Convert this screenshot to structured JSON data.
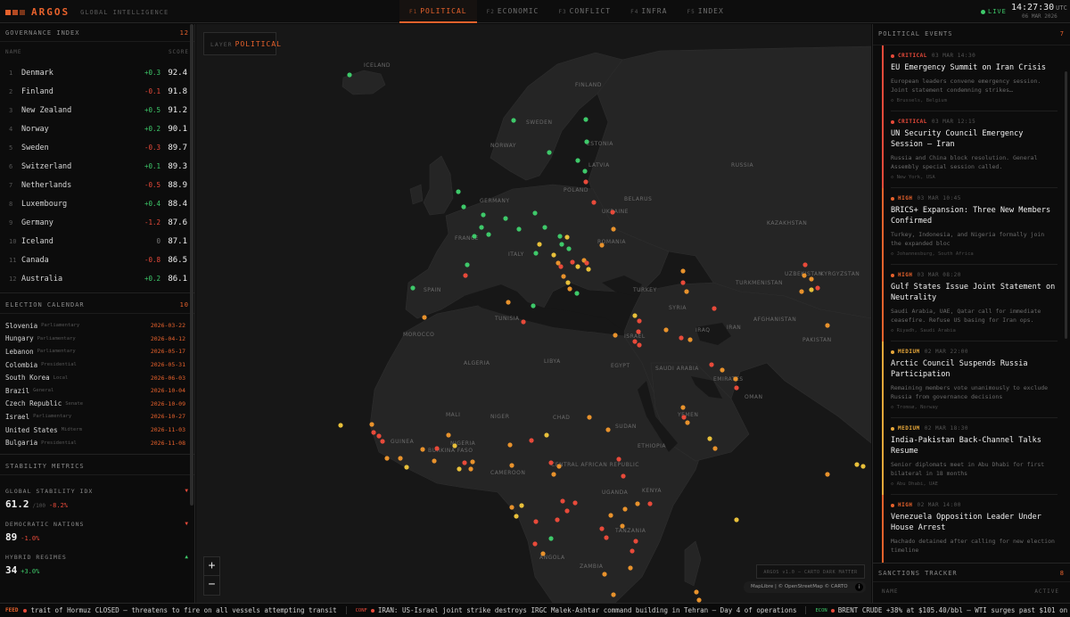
{
  "app": {
    "name": "ARGOS",
    "subtitle": "GLOBAL INTELLIGENCE"
  },
  "tabs": [
    {
      "key": "F1",
      "label": "POLITICAL",
      "active": true
    },
    {
      "key": "F2",
      "label": "ECONOMIC"
    },
    {
      "key": "F3",
      "label": "CONFLICT"
    },
    {
      "key": "F4",
      "label": "INFRA"
    },
    {
      "key": "F5",
      "label": "INDEX"
    }
  ],
  "status": {
    "live": "LIVE",
    "time": "14:27:30",
    "tz": "UTC",
    "date": "06 MAR 2026"
  },
  "governance": {
    "title": "GOVERNANCE INDEX",
    "count": "12",
    "col_name": "NAME",
    "col_score": "SCORE",
    "rows": [
      {
        "rank": "1",
        "name": "Denmark",
        "delta": "+0.3",
        "score": "92.4"
      },
      {
        "rank": "2",
        "name": "Finland",
        "delta": "-0.1",
        "score": "91.8"
      },
      {
        "rank": "3",
        "name": "New Zealand",
        "delta": "+0.5",
        "score": "91.2"
      },
      {
        "rank": "4",
        "name": "Norway",
        "delta": "+0.2",
        "score": "90.1"
      },
      {
        "rank": "5",
        "name": "Sweden",
        "delta": "-0.3",
        "score": "89.7"
      },
      {
        "rank": "6",
        "name": "Switzerland",
        "delta": "+0.1",
        "score": "89.3"
      },
      {
        "rank": "7",
        "name": "Netherlands",
        "delta": "-0.5",
        "score": "88.9"
      },
      {
        "rank": "8",
        "name": "Luxembourg",
        "delta": "+0.4",
        "score": "88.4"
      },
      {
        "rank": "9",
        "name": "Germany",
        "delta": "-1.2",
        "score": "87.6"
      },
      {
        "rank": "10",
        "name": "Iceland",
        "delta": "0",
        "score": "87.1"
      },
      {
        "rank": "11",
        "name": "Canada",
        "delta": "-0.8",
        "score": "86.5"
      },
      {
        "rank": "12",
        "name": "Australia",
        "delta": "+0.2",
        "score": "86.1"
      }
    ]
  },
  "elections": {
    "title": "ELECTION CALENDAR",
    "count": "10",
    "rows": [
      {
        "country": "Slovenia",
        "type": "Parliamentary",
        "date": "2026-03-22"
      },
      {
        "country": "Hungary",
        "type": "Parliamentary",
        "date": "2026-04-12"
      },
      {
        "country": "Lebanon",
        "type": "Parliamentary",
        "date": "2026-05-17"
      },
      {
        "country": "Colombia",
        "type": "Presidential",
        "date": "2026-05-31"
      },
      {
        "country": "South Korea",
        "type": "Local",
        "date": "2026-06-03"
      },
      {
        "country": "Brazil",
        "type": "General",
        "date": "2026-10-04"
      },
      {
        "country": "Czech Republic",
        "type": "Senate",
        "date": "2026-10-09"
      },
      {
        "country": "Israel",
        "type": "Parliamentary",
        "date": "2026-10-27"
      },
      {
        "country": "United States",
        "type": "Midterm",
        "date": "2026-11-03"
      },
      {
        "country": "Bulgaria",
        "type": "Presidential",
        "date": "2026-11-08"
      }
    ]
  },
  "stability": {
    "title": "STABILITY METRICS",
    "metrics": [
      {
        "label": "GLOBAL STABILITY IDX",
        "value": "61.2",
        "unit": "/100",
        "change": "-8.2%",
        "dir": "down"
      },
      {
        "label": "DEMOCRATIC NATIONS",
        "value": "89",
        "unit": "",
        "change": "-1.0%",
        "dir": "down"
      },
      {
        "label": "HYBRID REGIMES",
        "value": "34",
        "unit": "",
        "change": "+3.0%",
        "dir": "up"
      }
    ]
  },
  "map": {
    "layer_label": "LAYER",
    "layer_value": "POLITICAL",
    "brand": "ARGOS v1.0 — CARTO DARK MATTER",
    "attribution": "MapLibre | © OpenStreetMap © CARTO",
    "zoom_in": "+",
    "zoom_out": "−",
    "info_icon": "i",
    "labels": [
      {
        "text": "ICELAND"
      },
      {
        "text": "SWEDEN"
      },
      {
        "text": "FINLAND"
      },
      {
        "text": "NORWAY"
      },
      {
        "text": "ESTONIA"
      },
      {
        "text": "LATVIA"
      },
      {
        "text": "BELARUS"
      },
      {
        "text": "POLAND"
      },
      {
        "text": "GERMANY"
      },
      {
        "text": "UKRAINE"
      },
      {
        "text": "FRANCE"
      },
      {
        "text": "SPAIN"
      },
      {
        "text": "ITALY"
      },
      {
        "text": "ROMANIA"
      },
      {
        "text": "TURKEY"
      },
      {
        "text": "SYRIA"
      },
      {
        "text": "IRAQ"
      },
      {
        "text": "IRAN"
      },
      {
        "text": "KAZAKHSTAN"
      },
      {
        "text": "UZBEKISTAN"
      },
      {
        "text": "KYRGYZSTAN"
      },
      {
        "text": "TURKMENISTAN"
      },
      {
        "text": "AFGHANISTAN"
      },
      {
        "text": "PAKISTAN"
      },
      {
        "text": "TUNISIA"
      },
      {
        "text": "MOROCCO"
      },
      {
        "text": "ALGERIA"
      },
      {
        "text": "LIBYA"
      },
      {
        "text": "EGYPT"
      },
      {
        "text": "SAUDI ARABIA"
      },
      {
        "text": "EMIRATES"
      },
      {
        "text": "OMAN"
      },
      {
        "text": "YEMEN"
      },
      {
        "text": "MALI"
      },
      {
        "text": "NIGER"
      },
      {
        "text": "CHAD"
      },
      {
        "text": "SUDAN"
      },
      {
        "text": "ETHIOPIA"
      },
      {
        "text": "NIGERIA"
      },
      {
        "text": "CAMEROON"
      },
      {
        "text": "CENTRAL AFRICAN REPUBLIC"
      },
      {
        "text": "UGANDA"
      },
      {
        "text": "KENYA"
      },
      {
        "text": "TANZANIA"
      },
      {
        "text": "ANGOLA"
      },
      {
        "text": "ZAMBIA"
      },
      {
        "text": "GUINEA"
      },
      {
        "text": "BURKINA FASO"
      },
      {
        "text": "RUSSIA"
      },
      {
        "text": "ISRAEL"
      }
    ]
  },
  "events": {
    "title": "POLITICAL EVENTS",
    "count": "7",
    "items": [
      {
        "severity": "CRITICAL",
        "time": "03 MAR 14:30",
        "title": "EU Emergency Summit on Iran Crisis",
        "desc": "European leaders convene emergency session. Joint statement condemning strikes…",
        "loc": "◇ Brussels, Belgium"
      },
      {
        "severity": "CRITICAL",
        "time": "03 MAR 12:15",
        "title": "UN Security Council Emergency Session — Iran",
        "desc": "Russia and China block resolution. General Assembly special session called.",
        "loc": "◇ New York, USA"
      },
      {
        "severity": "HIGH",
        "time": "03 MAR 10:45",
        "title": "BRICS+ Expansion: Three New Members Confirmed",
        "desc": "Turkey, Indonesia, and Nigeria formally join the expanded bloc",
        "loc": "◇ Johannesburg, South Africa"
      },
      {
        "severity": "HIGH",
        "time": "03 MAR 08:20",
        "title": "Gulf States Issue Joint Statement on Neutrality",
        "desc": "Saudi Arabia, UAE, Qatar call for immediate ceasefire. Refuse US basing for Iran ops.",
        "loc": "◇ Riyadh, Saudi Arabia"
      },
      {
        "severity": "MEDIUM",
        "time": "02 MAR 22:00",
        "title": "Arctic Council Suspends Russia Participation",
        "desc": "Remaining members vote unanimously to exclude Russia from governance decisions",
        "loc": "◇ Tromsø, Norway"
      },
      {
        "severity": "MEDIUM",
        "time": "02 MAR 18:30",
        "title": "India-Pakistan Back-Channel Talks Resume",
        "desc": "Senior diplomats meet in Abu Dhabi for first bilateral in 18 months",
        "loc": "◇ Abu Dhabi, UAE"
      },
      {
        "severity": "HIGH",
        "time": "02 MAR 14:00",
        "title": "Venezuela Opposition Leader Under House Arrest",
        "desc": "Machado detained after calling for new election timeline",
        "loc": ""
      }
    ]
  },
  "sanctions": {
    "title": "SANCTIONS TRACKER",
    "count": "8",
    "col_name": "NAME",
    "col_status": "ACTIVE"
  },
  "ticker": {
    "feed": "FEED",
    "items": [
      {
        "tag": "",
        "text": "trait of Hormuz CLOSED — threatens to fire on all vessels attempting transit",
        "color": "#e84a3a"
      },
      {
        "tag": "CONF",
        "text": "IRAN: US-Israel joint strike destroys IRGC Malek-Ashtar command building in Tehran — Day 4 of operations",
        "color": "#e84a3a"
      },
      {
        "tag": "ECON",
        "text": "BRENT CRUDE +38% at $105.40/bbl — WTI surges past $101 on Hormuz clo",
        "color": "#e84a3a"
      }
    ]
  },
  "colors": {
    "accent": "#e8622c",
    "critical": "#e84a3a",
    "high": "#e8622c",
    "medium": "#e8a83a",
    "stable": "#3ec96a"
  }
}
